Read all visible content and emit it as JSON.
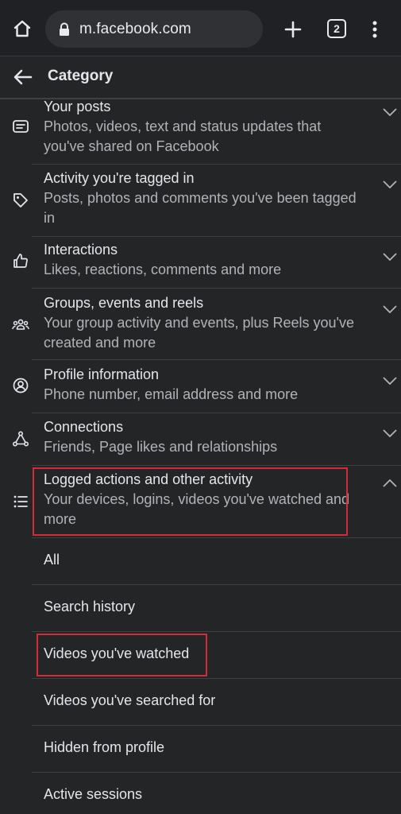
{
  "browser": {
    "url": "m.facebook.com",
    "tab_count": "2"
  },
  "header": {
    "title": "Category"
  },
  "categories": [
    {
      "title": "Your posts",
      "description": "Photos, videos, text and status updates that you've shared on Facebook",
      "icon": "posts-icon",
      "expanded": false
    },
    {
      "title": "Activity you're tagged in",
      "description": "Posts, photos and comments you've been tagged in",
      "icon": "tag-icon",
      "expanded": false
    },
    {
      "title": "Interactions",
      "description": "Likes, reactions, comments and more",
      "icon": "thumbs-up-icon",
      "expanded": false
    },
    {
      "title": "Groups, events and reels",
      "description": "Your group activity and events, plus Reels you've created and more",
      "icon": "groups-icon",
      "expanded": false
    },
    {
      "title": "Profile information",
      "description": "Phone number, email address and more",
      "icon": "profile-icon",
      "expanded": false
    },
    {
      "title": "Connections",
      "description": "Friends, Page likes and relationships",
      "icon": "connections-icon",
      "expanded": false
    },
    {
      "title": "Logged actions and other activity",
      "description": "Your devices, logins, videos you've watched and more",
      "icon": "list-icon",
      "expanded": true
    }
  ],
  "sub_items": [
    {
      "label": "All"
    },
    {
      "label": "Search history"
    },
    {
      "label": "Videos you've watched"
    },
    {
      "label": "Videos you've searched for"
    },
    {
      "label": "Hidden from profile"
    },
    {
      "label": "Active sessions"
    }
  ],
  "colors": {
    "background": "#242526",
    "highlight": "#d42a3a",
    "text_primary": "#e4e6eb",
    "text_secondary": "#b0b3b8"
  }
}
